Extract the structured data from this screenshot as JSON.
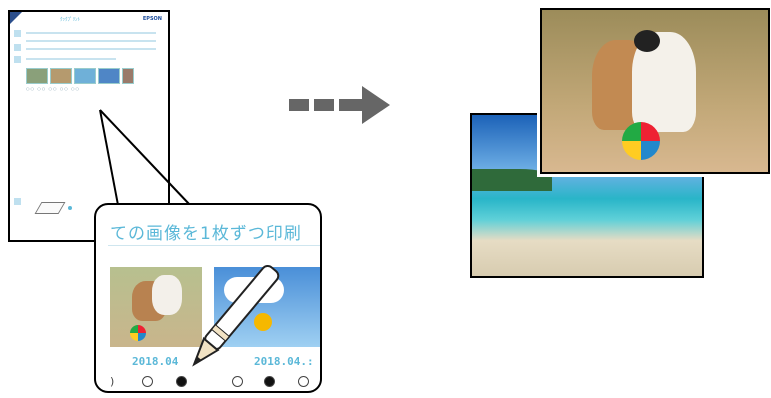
{
  "sheet": {
    "title": "ｸｯｸﾌﾟﾘﾝﾄ",
    "brand": "EPSON"
  },
  "callout": {
    "title": "ての画像を1枚ずつ印刷",
    "photos": [
      {
        "date": "2018.04"
      },
      {
        "date": "2018.04.:"
      }
    ]
  },
  "colors": {
    "accent": "#5bb8d8",
    "arrow": "#666666",
    "outline": "#000000"
  },
  "icons": [
    "pencil-icon",
    "arrow-right-icon",
    "scanner-icon"
  ]
}
